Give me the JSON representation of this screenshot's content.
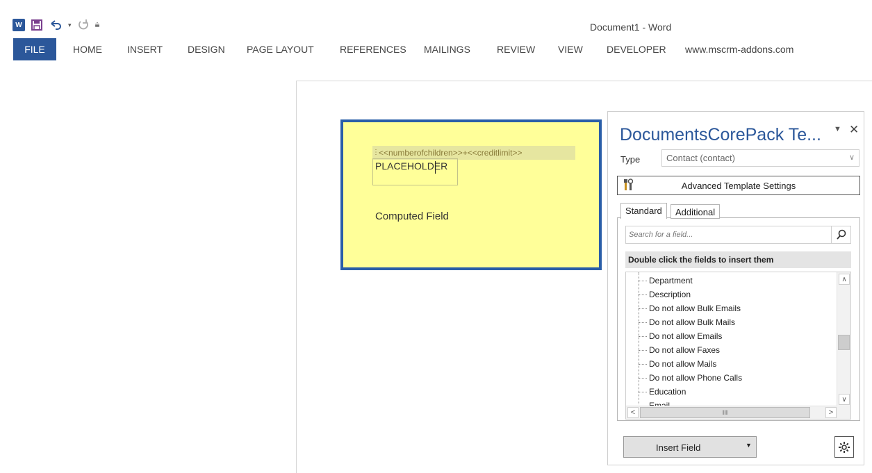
{
  "app": {
    "window_title": "Document1 - Word",
    "quick_access": {
      "logo_letter": "W",
      "save_icon": "save-icon",
      "undo_icon": "undo-icon",
      "redo_icon": "redo-icon",
      "customize_icon": "customize-qat-icon"
    }
  },
  "ribbon": {
    "tabs": [
      {
        "label": "FILE"
      },
      {
        "label": "HOME"
      },
      {
        "label": "INSERT"
      },
      {
        "label": "DESIGN"
      },
      {
        "label": "PAGE LAYOUT"
      },
      {
        "label": "REFERENCES"
      },
      {
        "label": "MAILINGS"
      },
      {
        "label": "REVIEW"
      },
      {
        "label": "VIEW"
      },
      {
        "label": "DEVELOPER"
      },
      {
        "label": "www.mscrm-addons.com"
      }
    ]
  },
  "document": {
    "merge_field": "<<numberofchildren>>+<<creditlimit>>",
    "placeholder": "PLACEHOLDER",
    "computed_label": "Computed Field"
  },
  "pane": {
    "title": "DocumentsCorePack Te...",
    "type_label": "Type",
    "type_value": "Contact (contact)",
    "advanced_button": "Advanced Template Settings",
    "tabs": {
      "standard": "Standard",
      "additional": "Additional"
    },
    "search_placeholder": "Search for a field...",
    "instruction": "Double click the fields to insert them",
    "fields": [
      "Department",
      "Description",
      "Do not allow Bulk Emails",
      "Do not allow Bulk Mails",
      "Do not allow Emails",
      "Do not allow Faxes",
      "Do not allow Mails",
      "Do not allow Phone Calls",
      "Education",
      "Email"
    ],
    "hscroll_thumb": "III",
    "insert_button": "Insert Field"
  },
  "colors": {
    "word_blue": "#2b579a",
    "textbox_fill": "#ffff99",
    "textbox_border": "#2a5ea8"
  }
}
